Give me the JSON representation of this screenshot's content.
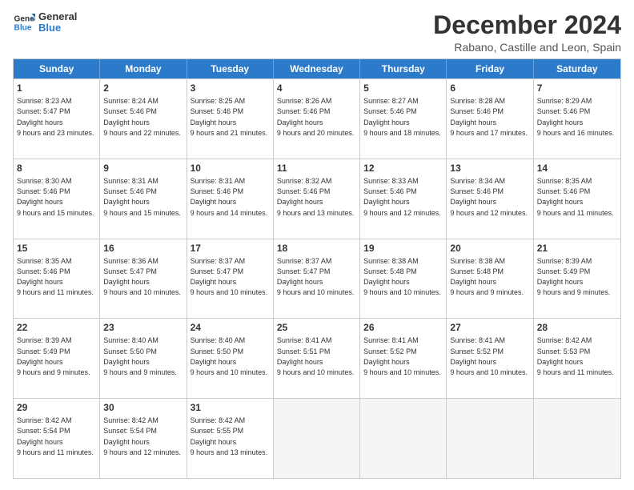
{
  "logo": {
    "line1": "General",
    "line2": "Blue"
  },
  "title": "December 2024",
  "subtitle": "Rabano, Castille and Leon, Spain",
  "days": [
    "Sunday",
    "Monday",
    "Tuesday",
    "Wednesday",
    "Thursday",
    "Friday",
    "Saturday"
  ],
  "weeks": [
    [
      {
        "day": "1",
        "sunrise": "8:23 AM",
        "sunset": "5:47 PM",
        "daylight": "9 hours and 23 minutes."
      },
      {
        "day": "2",
        "sunrise": "8:24 AM",
        "sunset": "5:46 PM",
        "daylight": "9 hours and 22 minutes."
      },
      {
        "day": "3",
        "sunrise": "8:25 AM",
        "sunset": "5:46 PM",
        "daylight": "9 hours and 21 minutes."
      },
      {
        "day": "4",
        "sunrise": "8:26 AM",
        "sunset": "5:46 PM",
        "daylight": "9 hours and 20 minutes."
      },
      {
        "day": "5",
        "sunrise": "8:27 AM",
        "sunset": "5:46 PM",
        "daylight": "9 hours and 18 minutes."
      },
      {
        "day": "6",
        "sunrise": "8:28 AM",
        "sunset": "5:46 PM",
        "daylight": "9 hours and 17 minutes."
      },
      {
        "day": "7",
        "sunrise": "8:29 AM",
        "sunset": "5:46 PM",
        "daylight": "9 hours and 16 minutes."
      }
    ],
    [
      {
        "day": "8",
        "sunrise": "8:30 AM",
        "sunset": "5:46 PM",
        "daylight": "9 hours and 15 minutes."
      },
      {
        "day": "9",
        "sunrise": "8:31 AM",
        "sunset": "5:46 PM",
        "daylight": "9 hours and 15 minutes."
      },
      {
        "day": "10",
        "sunrise": "8:31 AM",
        "sunset": "5:46 PM",
        "daylight": "9 hours and 14 minutes."
      },
      {
        "day": "11",
        "sunrise": "8:32 AM",
        "sunset": "5:46 PM",
        "daylight": "9 hours and 13 minutes."
      },
      {
        "day": "12",
        "sunrise": "8:33 AM",
        "sunset": "5:46 PM",
        "daylight": "9 hours and 12 minutes."
      },
      {
        "day": "13",
        "sunrise": "8:34 AM",
        "sunset": "5:46 PM",
        "daylight": "9 hours and 12 minutes."
      },
      {
        "day": "14",
        "sunrise": "8:35 AM",
        "sunset": "5:46 PM",
        "daylight": "9 hours and 11 minutes."
      }
    ],
    [
      {
        "day": "15",
        "sunrise": "8:35 AM",
        "sunset": "5:46 PM",
        "daylight": "9 hours and 11 minutes."
      },
      {
        "day": "16",
        "sunrise": "8:36 AM",
        "sunset": "5:47 PM",
        "daylight": "9 hours and 10 minutes."
      },
      {
        "day": "17",
        "sunrise": "8:37 AM",
        "sunset": "5:47 PM",
        "daylight": "9 hours and 10 minutes."
      },
      {
        "day": "18",
        "sunrise": "8:37 AM",
        "sunset": "5:47 PM",
        "daylight": "9 hours and 10 minutes."
      },
      {
        "day": "19",
        "sunrise": "8:38 AM",
        "sunset": "5:48 PM",
        "daylight": "9 hours and 10 minutes."
      },
      {
        "day": "20",
        "sunrise": "8:38 AM",
        "sunset": "5:48 PM",
        "daylight": "9 hours and 9 minutes."
      },
      {
        "day": "21",
        "sunrise": "8:39 AM",
        "sunset": "5:49 PM",
        "daylight": "9 hours and 9 minutes."
      }
    ],
    [
      {
        "day": "22",
        "sunrise": "8:39 AM",
        "sunset": "5:49 PM",
        "daylight": "9 hours and 9 minutes."
      },
      {
        "day": "23",
        "sunrise": "8:40 AM",
        "sunset": "5:50 PM",
        "daylight": "9 hours and 9 minutes."
      },
      {
        "day": "24",
        "sunrise": "8:40 AM",
        "sunset": "5:50 PM",
        "daylight": "9 hours and 10 minutes."
      },
      {
        "day": "25",
        "sunrise": "8:41 AM",
        "sunset": "5:51 PM",
        "daylight": "9 hours and 10 minutes."
      },
      {
        "day": "26",
        "sunrise": "8:41 AM",
        "sunset": "5:52 PM",
        "daylight": "9 hours and 10 minutes."
      },
      {
        "day": "27",
        "sunrise": "8:41 AM",
        "sunset": "5:52 PM",
        "daylight": "9 hours and 10 minutes."
      },
      {
        "day": "28",
        "sunrise": "8:42 AM",
        "sunset": "5:53 PM",
        "daylight": "9 hours and 11 minutes."
      }
    ],
    [
      {
        "day": "29",
        "sunrise": "8:42 AM",
        "sunset": "5:54 PM",
        "daylight": "9 hours and 11 minutes."
      },
      {
        "day": "30",
        "sunrise": "8:42 AM",
        "sunset": "5:54 PM",
        "daylight": "9 hours and 12 minutes."
      },
      {
        "day": "31",
        "sunrise": "8:42 AM",
        "sunset": "5:55 PM",
        "daylight": "9 hours and 13 minutes."
      },
      null,
      null,
      null,
      null
    ]
  ]
}
